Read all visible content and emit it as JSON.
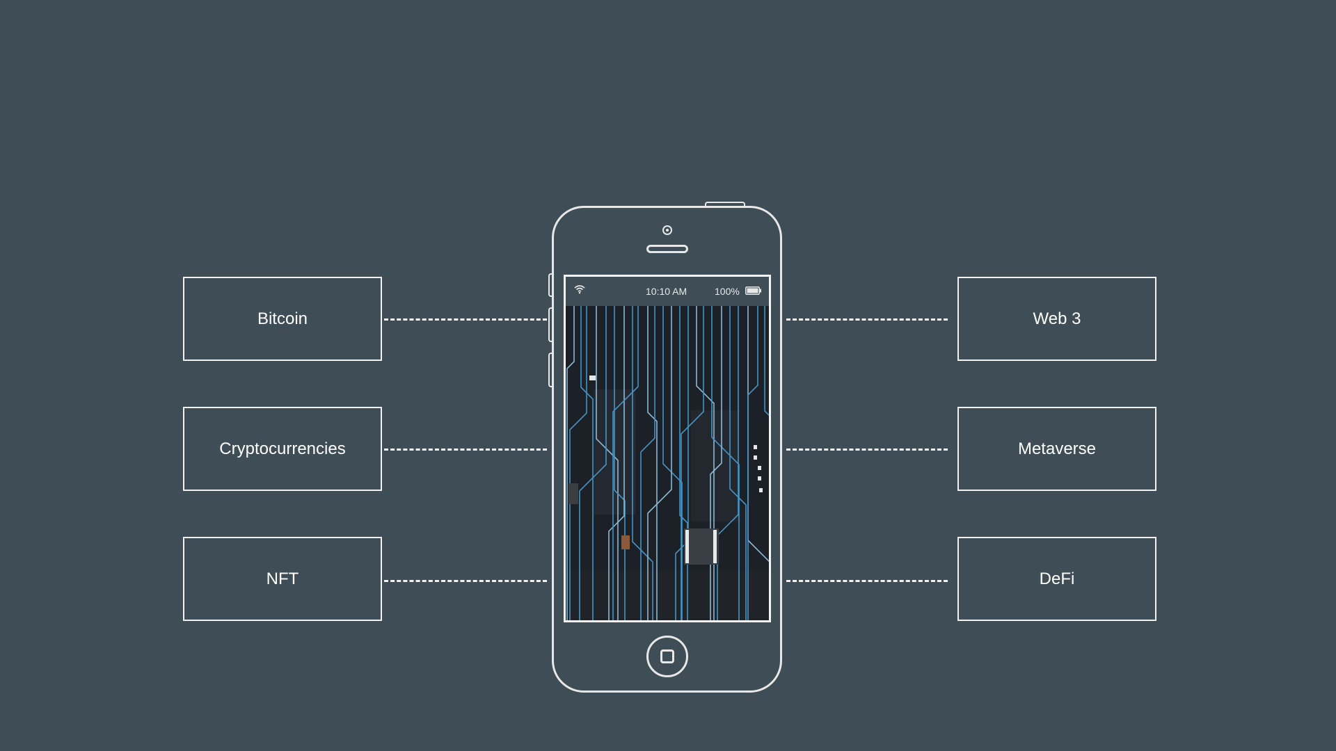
{
  "topics_left": [
    "Bitcoin",
    "Cryptocurrencies",
    "NFT"
  ],
  "topics_right": [
    "Web 3",
    "Metaverse",
    "DeFi"
  ],
  "phone": {
    "status_time": "10:10 AM",
    "battery_text": "100%"
  },
  "colors": {
    "background": "#3f4e56",
    "line": "#f2f2f2",
    "circuit_blue": "#4aa8e0"
  },
  "icons": [
    "wifi-icon",
    "battery-icon",
    "camera-icon",
    "speaker-icon",
    "home-button-icon"
  ]
}
